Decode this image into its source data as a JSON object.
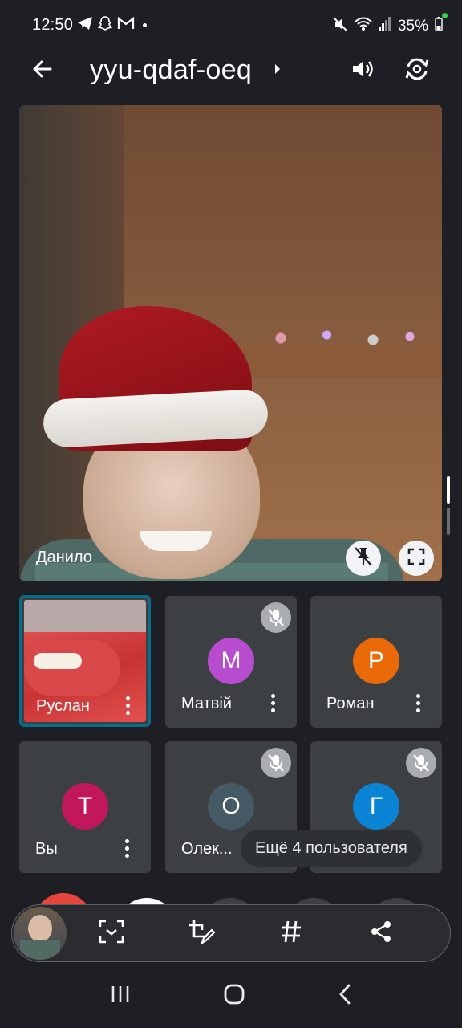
{
  "status_bar": {
    "time": "12:50",
    "battery": "35%",
    "left_icons": [
      "telegram-icon",
      "snapchat-icon",
      "gmail-icon",
      "dot-icon"
    ],
    "right_icons": [
      "mute-icon",
      "wifi-icon",
      "signal-icon",
      "battery-icon"
    ]
  },
  "top_bar": {
    "back_icon": "arrow-left-icon",
    "meeting_code": "yyu-qdaf-oeq",
    "expand_icon": "chevron-right-icon",
    "audio_icon": "speaker-icon",
    "camera_switch_icon": "switch-camera-icon"
  },
  "main_video": {
    "name": "Данило",
    "pin_icon": "unpin-icon",
    "fullscreen_icon": "fullscreen-icon"
  },
  "participants": [
    {
      "name": "Руслан",
      "has_video": true,
      "muted": false,
      "active": true
    },
    {
      "name": "Матвій",
      "initial": "М",
      "avatar_color": "#b84ccf",
      "muted": true
    },
    {
      "name": "Роман",
      "initial": "Р",
      "avatar_color": "#ea6a0a",
      "muted": false
    },
    {
      "name": "Вы",
      "initial": "Т",
      "avatar_color": "#c2185b",
      "muted": false
    },
    {
      "name": "Олек...",
      "initial": "О",
      "avatar_color": "#455a64",
      "muted": true
    },
    {
      "name": "",
      "initial": "Г",
      "avatar_color": "#0b84d6",
      "muted": true
    }
  ],
  "more_participants": "Ещё 4 пользователя",
  "floating_toolbar": {
    "items": [
      "screenshot-scan-icon",
      "edit-crop-icon",
      "hashtag-icon",
      "share-icon"
    ]
  },
  "nav_bar": [
    "recent-apps-icon",
    "home-icon",
    "back-icon"
  ],
  "colors": {
    "background": "#1d1f24",
    "tile": "#3c4043",
    "active_border": "#0b6b8a"
  }
}
